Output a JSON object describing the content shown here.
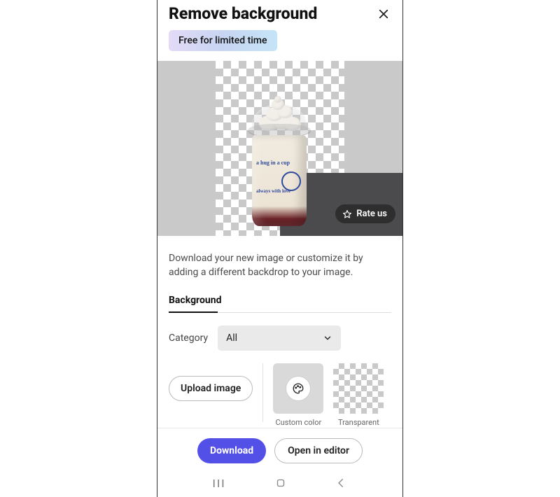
{
  "header": {
    "title": "Remove background"
  },
  "badge": {
    "text": "Free for limited time"
  },
  "preview": {
    "rate_label": "Rate us",
    "cup_text_line1": "a hug in a cup",
    "cup_text_line2": "always with love"
  },
  "description": "Download your new image or customize it by adding a different backdrop to your image.",
  "tabs": {
    "background": "Background"
  },
  "category": {
    "label": "Category",
    "selected": "All"
  },
  "options": {
    "upload_label": "Upload image",
    "custom_color_label": "Custom color",
    "transparent_label": "Transparent"
  },
  "footer": {
    "download_label": "Download",
    "open_editor_label": "Open in editor"
  },
  "colors": {
    "primary": "#5350e8"
  }
}
